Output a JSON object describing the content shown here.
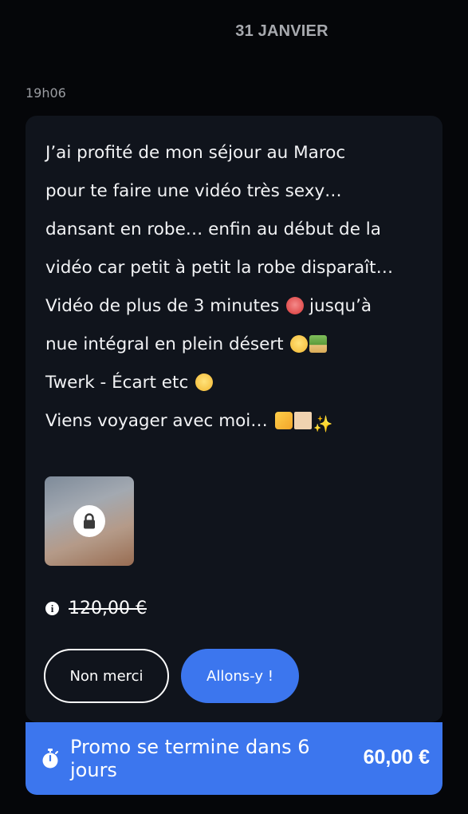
{
  "date_header": "31 JANVIER",
  "message": {
    "time": "19h06",
    "lines": [
      "J’ai profité de mon séjour au Maroc",
      "pour te faire une vidéo très sexy…",
      "dansant en robe… enfin au début de la",
      "vidéo car petit à petit la robe disparaît…",
      "Vidéo de plus de 3 minutes",
      "jusqu’à",
      "nue intégral en plein désert",
      "Twerk - Écart etc",
      "Viens voyager avec moi…"
    ],
    "sparkle": "✨"
  },
  "media": {
    "icon": "lock-icon",
    "locked": true
  },
  "offer": {
    "original_price": "120,00 €",
    "info_glyph": "i",
    "decline_label": "Non merci",
    "accept_label": "Allons-y !",
    "accent_color": "#3c76ee"
  },
  "promo": {
    "text": "Promo se termine dans 6 jours",
    "price": "60,00 €",
    "icon": "stopwatch-icon"
  }
}
